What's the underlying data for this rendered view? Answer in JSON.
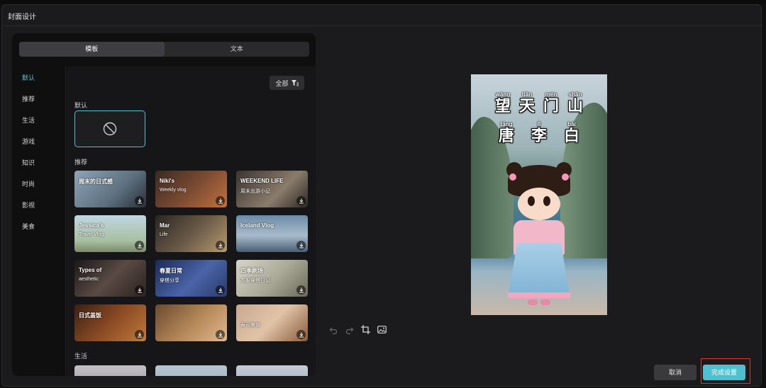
{
  "dialog": {
    "title": "封面设计"
  },
  "tabs": [
    {
      "label": "模板",
      "active": true
    },
    {
      "label": "文本",
      "active": false
    }
  ],
  "sidebar": {
    "items": [
      {
        "label": "默认",
        "active": true
      },
      {
        "label": "推荐"
      },
      {
        "label": "生活"
      },
      {
        "label": "游戏"
      },
      {
        "label": "知识"
      },
      {
        "label": "时尚"
      },
      {
        "label": "影视"
      },
      {
        "label": "美食"
      }
    ]
  },
  "filter": {
    "label": "全部"
  },
  "sections": {
    "default": "默认",
    "recommend": "推荐",
    "life": "生活"
  },
  "templates": [
    {
      "caption": "周末的日式感",
      "sub": "",
      "bg": "linear-gradient(135deg,#8ea4b8,#5c6f7e 60%,#2a2f36)"
    },
    {
      "caption": "Niki's",
      "sub": "Weekly vlog",
      "bg": "linear-gradient(135deg,#3a2a22,#7a4a32 50%,#c07040)"
    },
    {
      "caption": "WEEKEND LIFE",
      "sub": "周末出游小记",
      "bg": "linear-gradient(135deg,#3a3430,#8a7c6c 60%,#2a2622)"
    },
    {
      "caption": "Jessica's",
      "sub": "Travel Vlog",
      "bg": "linear-gradient(180deg,#c0d6e2,#a8bfa0 70%,#7a8a6a)"
    },
    {
      "caption": "Mar",
      "sub": "Life",
      "bg": "linear-gradient(135deg,#2a2622,#6e5e4a 55%,#b89a70)"
    },
    {
      "caption": "Iceland Vlog",
      "sub": "",
      "bg": "linear-gradient(180deg,#6c8aa6,#a8bccc 55%,#4a5e72)"
    },
    {
      "caption": "Types of",
      "sub": "aesthetic",
      "bg": "linear-gradient(135deg,#1a1818,#5a4a44 50%,#2a2220)"
    },
    {
      "caption": "春夏日常",
      "sub": "穿搭分享",
      "bg": "linear-gradient(135deg,#1c2a5a,#4a64a8 55%,#2a3a6a)"
    },
    {
      "caption": "四季剧场",
      "sub": "衣服穿搭日记",
      "bg": "linear-gradient(135deg,#d8d6c8,#a8a694 55%,#6a6856)"
    },
    {
      "caption": "日式盖饭",
      "sub": "",
      "bg": "linear-gradient(135deg,#3a2014,#8a4a24 50%,#c07a3a)"
    },
    {
      "caption": "",
      "sub": "",
      "bg": "linear-gradient(135deg,#6a4a30,#b88a5a 55%,#e0b890)"
    },
    {
      "caption": "",
      "sub": "寿司美食",
      "bg": "linear-gradient(135deg,#c8a890,#e0c4a8 50%,#8a5a3a)"
    }
  ],
  "preview": {
    "line1": [
      {
        "py": "wàng",
        "hz": "望"
      },
      {
        "py": "tiān",
        "hz": "天"
      },
      {
        "py": "mén",
        "hz": "门"
      },
      {
        "py": "shān",
        "hz": "山"
      }
    ],
    "line2": [
      {
        "py": "táng",
        "hz": "唐"
      },
      {
        "py": "lǐ",
        "hz": "李"
      },
      {
        "py": "bái",
        "hz": "白"
      }
    ]
  },
  "icons": [
    "undo-icon",
    "redo-icon",
    "crop-icon",
    "replace-image-icon",
    "filter-icon",
    "download-icon",
    "no-cover-icon"
  ],
  "actions": {
    "cancel": "取消",
    "done": "完成设置"
  },
  "colors": {
    "accent": "#4ec1d0",
    "highlight": "#e0342a"
  }
}
